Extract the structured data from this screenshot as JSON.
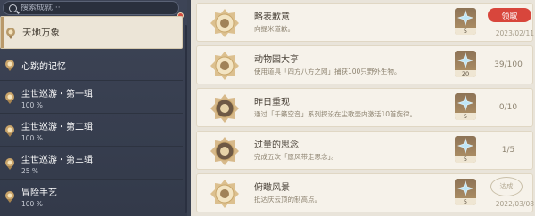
{
  "search": {
    "placeholder": "搜索成就···"
  },
  "sidebar": {
    "items": [
      {
        "name": "天地万象",
        "percent": "",
        "selected": true
      },
      {
        "name": "心跳的记忆",
        "percent": ""
      },
      {
        "name": "尘世巡游・第一辑",
        "percent": "100 %"
      },
      {
        "name": "尘世巡游・第二辑",
        "percent": "100 %"
      },
      {
        "name": "尘世巡游・第三辑",
        "percent": "25 %"
      },
      {
        "name": "冒险手艺",
        "percent": "100 %"
      }
    ]
  },
  "achievements": [
    {
      "title": "略表歉意",
      "desc": "向提米道歉。",
      "reward": "5",
      "action": "领取",
      "date": "2023/02/11",
      "status": "claimable"
    },
    {
      "title": "动物园大亨",
      "desc": "使用道具「四方八方之网」捕获100只野外生物。",
      "reward": "20",
      "progress": "39/100",
      "status": "in-progress"
    },
    {
      "title": "昨日重现",
      "desc": "通过「千籁空音」系列探设在尘歌壶内激活10首旋律。",
      "reward": "5",
      "progress": "0/10",
      "status": "in-progress"
    },
    {
      "title": "过量的思念",
      "desc": "完成五次「愿风带走思念」。",
      "reward": "5",
      "progress": "1/5",
      "status": "in-progress"
    },
    {
      "title": "俯瞰风景",
      "desc": "抵达庆云顶的制高点。",
      "reward": "5",
      "stamp": "达成",
      "date": "2022/03/08",
      "status": "completed"
    }
  ],
  "colors": {
    "sidebar_bg": "#3b4252",
    "selected_bg": "#ece5d7",
    "claim_button": "#d8463c",
    "card_bg": "#f6f2ea",
    "primogem": "#9fd3ee"
  }
}
